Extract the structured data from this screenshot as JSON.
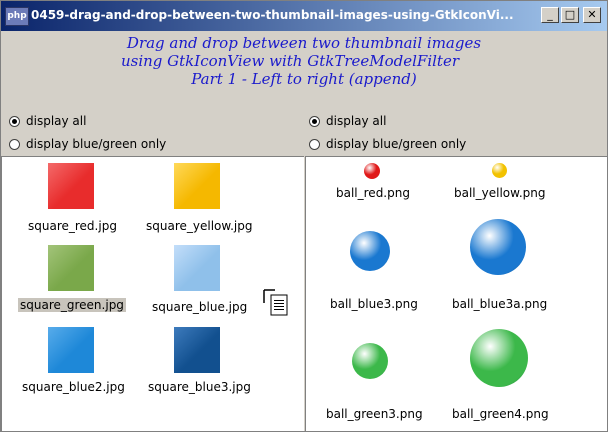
{
  "window": {
    "title": "0459-drag-and-drop-between-two-thumbnail-images-using-GtkIconVi...",
    "app_icon_label": "php",
    "minimize": "_",
    "maximize": "□",
    "close": "✕"
  },
  "header": {
    "line1": "Drag and drop between two thumbnail images",
    "line2": "using GtkIconView with GtkTreeModelFilter",
    "line3": "Part 1 - Left to right (append)"
  },
  "left": {
    "radio_all": "display all",
    "radio_bluegreen": "display blue/green only",
    "items": [
      {
        "label": "square_red.jpg",
        "color": "#e82c2c",
        "color2": "#f46a6a"
      },
      {
        "label": "square_yellow.jpg",
        "color": "#f5b800",
        "color2": "#ffd95a"
      },
      {
        "label": "square_green.jpg",
        "color": "#7aa84a",
        "color2": "#a3c47a"
      },
      {
        "label": "square_blue.jpg",
        "color": "#8fc0ea",
        "color2": "#c3defa"
      },
      {
        "label": "square_blue2.jpg",
        "color": "#1e88d8",
        "color2": "#58aceb"
      },
      {
        "label": "square_blue3.jpg",
        "color": "#12508f",
        "color2": "#3d7bbd"
      }
    ]
  },
  "right": {
    "radio_all": "display all",
    "radio_bluegreen": "display blue/green only",
    "items": [
      {
        "label": "ball_red.png",
        "color": "#e01818"
      },
      {
        "label": "ball_yellow.png",
        "color": "#f2c200"
      },
      {
        "label": "ball_blue3.png",
        "color": "#1a78d0"
      },
      {
        "label": "ball_blue3a.png",
        "color": "#1a78d0"
      },
      {
        "label": "ball_green3.png",
        "color": "#3cb84a"
      },
      {
        "label": "ball_green4.png",
        "color": "#3cb84a"
      }
    ]
  }
}
